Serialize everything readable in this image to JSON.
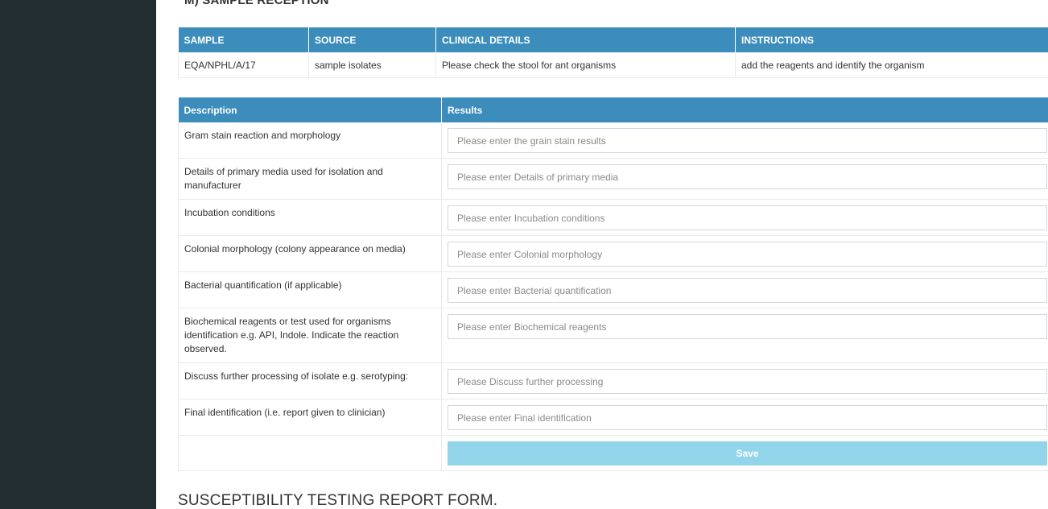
{
  "section_title": "M) SAMPLE RECEPTION",
  "sample_table": {
    "headers": [
      "SAMPLE",
      "SOURCE",
      "CLINICAL DETAILS",
      "INSTRUCTIONS"
    ],
    "row": [
      "EQA/NPHL/A/17",
      "sample isolates",
      "Please check the stool for ant organisms",
      "add the reagents and identify the organism"
    ]
  },
  "results_table": {
    "headers": [
      "Description",
      "Results"
    ],
    "rows": [
      {
        "description": "Gram stain reaction and morphology",
        "placeholder": "Please enter the grain stain results"
      },
      {
        "description": "Details of primary media used for isolation and manufacturer",
        "placeholder": "Please enter Details of primary media"
      },
      {
        "description": "Incubation conditions",
        "placeholder": "Please enter Incubation conditions"
      },
      {
        "description": "Colonial morphology (colony appearance on media)",
        "placeholder": "Please enter Colonial morphology"
      },
      {
        "description": "Bacterial quantification (if applicable)",
        "placeholder": "Please enter Bacterial quantification"
      },
      {
        "description": "Biochemical reagents or test used for organisms identification e.g. API, Indole. Indicate the reaction observed.",
        "placeholder": "Please enter Biochemical reagents"
      },
      {
        "description": "Discuss further processing of isolate e.g. serotyping:",
        "placeholder": "Please Discuss further processing"
      },
      {
        "description": "Final identification (i.e. report given to clinician)",
        "placeholder": "Please enter Final identification"
      }
    ],
    "save_label": "Save"
  },
  "susceptibility_title": "SUSCEPTIBILITY TESTING REPORT FORM."
}
